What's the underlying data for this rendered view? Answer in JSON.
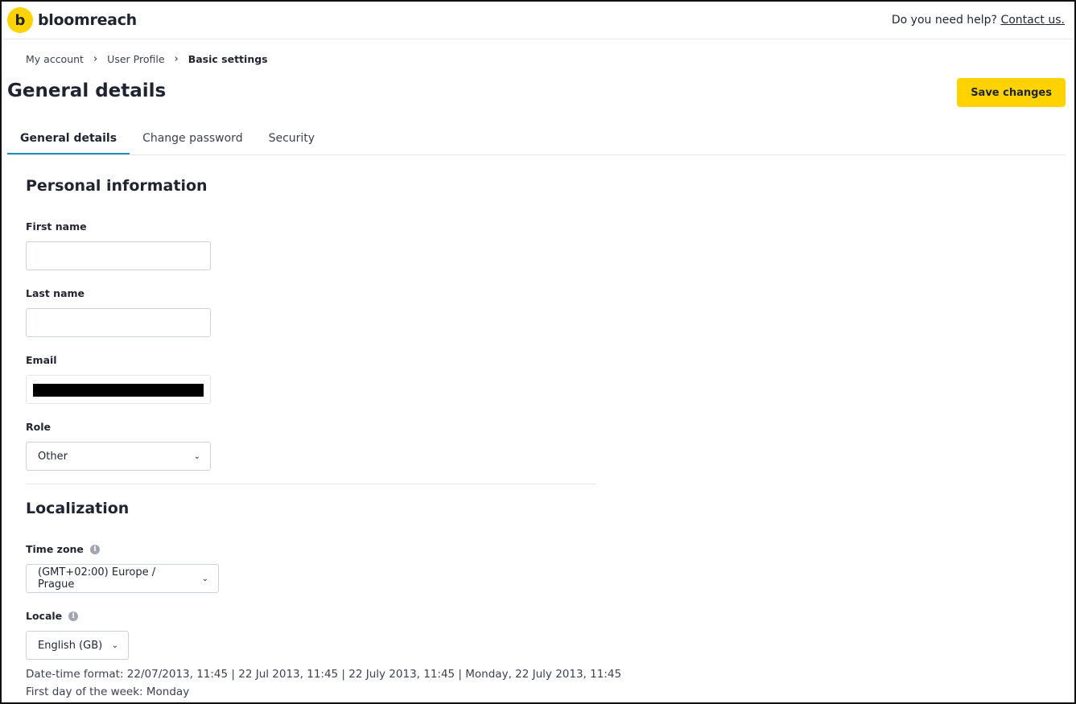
{
  "header": {
    "brand_mark": "b",
    "brand_name": "bloomreach",
    "help_text": "Do you need help?",
    "contact_link": "Contact us."
  },
  "breadcrumb": {
    "items": [
      "My account",
      "User Profile",
      "Basic settings"
    ]
  },
  "page": {
    "title": "General details",
    "save_label": "Save changes"
  },
  "tabs": [
    {
      "label": "General details",
      "active": true
    },
    {
      "label": "Change password",
      "active": false
    },
    {
      "label": "Security",
      "active": false
    }
  ],
  "personal": {
    "title": "Personal information",
    "first_name_label": "First name",
    "first_name_value": "",
    "last_name_label": "Last name",
    "last_name_value": "",
    "email_label": "Email",
    "email_value": "",
    "role_label": "Role",
    "role_value": "Other"
  },
  "localization": {
    "title": "Localization",
    "timezone_label": "Time zone",
    "timezone_value": "(GMT+02:00) Europe / Prague",
    "locale_label": "Locale",
    "locale_value": "English (GB)",
    "datetime_format": "Date-time format: 22/07/2013, 11:45 | 22 Jul 2013, 11:45 | 22 July 2013, 11:45 | Monday, 22 July 2013, 11:45",
    "first_day": "First day of the week: Monday"
  },
  "icons": {
    "chevron": "chevron-down-icon",
    "breadcrumb_separator": "chevron-right-icon",
    "info": "info-icon"
  },
  "colors": {
    "accent_yellow": "#ffd200",
    "tab_underline": "#1f8fb6",
    "text_dark": "#1f2430"
  }
}
